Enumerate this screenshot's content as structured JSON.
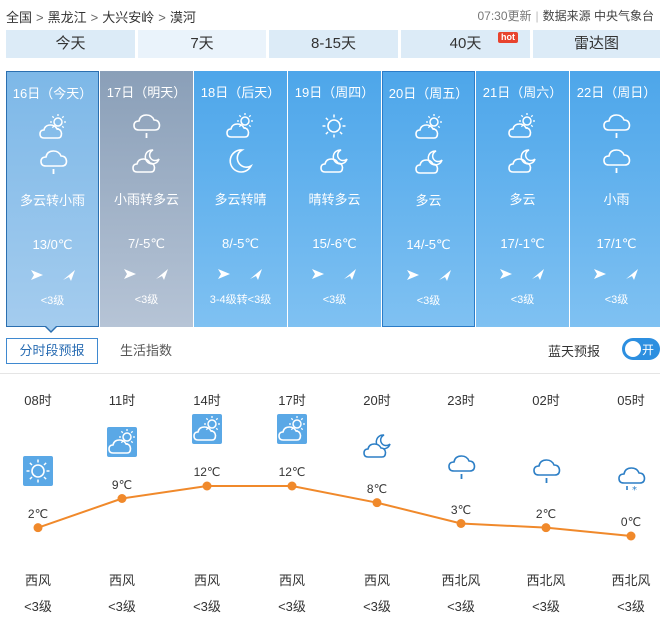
{
  "breadcrumb": {
    "items": [
      "全国",
      "黑龙江",
      "大兴安岭",
      "漠河"
    ],
    "sep": ">"
  },
  "meta": {
    "updated": "07:30更新",
    "source_label": "数据来源 中央气象台"
  },
  "tabs": [
    {
      "label": "今天",
      "active": false
    },
    {
      "label": "7天",
      "active": true
    },
    {
      "label": "8-15天",
      "active": false
    },
    {
      "label": "40天",
      "active": false,
      "badge": "hot"
    },
    {
      "label": "雷达图",
      "active": false
    }
  ],
  "days": [
    {
      "date": "16日（今天）",
      "icon_day": "partly-cloudy-icon",
      "icon_night": "light-rain-icon",
      "desc": "多云转小雨",
      "temp": "13/0℃",
      "wind_level": "<3级"
    },
    {
      "date": "17日（明天）",
      "icon_day": "light-rain-icon",
      "icon_night": "partly-cloudy-night-icon",
      "desc": "小雨转多云",
      "temp": "7/-5℃",
      "wind_level": "<3级"
    },
    {
      "date": "18日（后天）",
      "icon_day": "partly-cloudy-icon",
      "icon_night": "moon-icon",
      "desc": "多云转晴",
      "temp": "8/-5℃",
      "wind_level": "3-4级转<3级"
    },
    {
      "date": "19日（周四）",
      "icon_day": "sunny-icon",
      "icon_night": "partly-cloudy-night-icon",
      "desc": "晴转多云",
      "temp": "15/-6℃",
      "wind_level": "<3级"
    },
    {
      "date": "20日（周五）",
      "icon_day": "partly-cloudy-icon",
      "icon_night": "partly-cloudy-night-icon",
      "desc": "多云",
      "temp": "14/-5℃",
      "wind_level": "<3级"
    },
    {
      "date": "21日（周六）",
      "icon_day": "partly-cloudy-icon",
      "icon_night": "partly-cloudy-night-icon",
      "desc": "多云",
      "temp": "17/-1℃",
      "wind_level": "<3级"
    },
    {
      "date": "22日（周日）",
      "icon_day": "light-rain-icon",
      "icon_night": "light-rain-icon",
      "desc": "小雨",
      "temp": "17/1℃",
      "wind_level": "<3级"
    }
  ],
  "subtabs": {
    "hourly": "分时段预报",
    "life": "生活指数"
  },
  "bluesky": {
    "label": "蓝天预报",
    "toggle": "开"
  },
  "hourly": [
    {
      "time": "08时",
      "icon": "sunny-icon",
      "temp": "2℃",
      "temp_value": 2,
      "dir": "西风",
      "lvl": "<3级"
    },
    {
      "time": "11时",
      "icon": "partly-cloudy-icon",
      "temp": "9℃",
      "temp_value": 9,
      "dir": "西风",
      "lvl": "<3级"
    },
    {
      "time": "14时",
      "icon": "partly-cloudy-icon",
      "temp": "12℃",
      "temp_value": 12,
      "dir": "西风",
      "lvl": "<3级"
    },
    {
      "time": "17时",
      "icon": "partly-cloudy-icon",
      "temp": "12℃",
      "temp_value": 12,
      "dir": "西风",
      "lvl": "<3级"
    },
    {
      "time": "20时",
      "icon": "partly-cloudy-night-icon",
      "temp": "8℃",
      "temp_value": 8,
      "dir": "西风",
      "lvl": "<3级"
    },
    {
      "time": "23时",
      "icon": "light-rain-icon",
      "temp": "3℃",
      "temp_value": 3,
      "dir": "西北风",
      "lvl": "<3级"
    },
    {
      "time": "02时",
      "icon": "light-rain-icon",
      "temp": "2℃",
      "temp_value": 2,
      "dir": "西北风",
      "lvl": "<3级"
    },
    {
      "time": "05时",
      "icon": "rain-snow-icon",
      "temp": "0℃",
      "temp_value": 0,
      "dir": "西北风",
      "lvl": "<3级"
    }
  ],
  "colors": {
    "accent": "#3f89d0",
    "curve": "#f0892b",
    "day_card": "#4da6ea"
  }
}
